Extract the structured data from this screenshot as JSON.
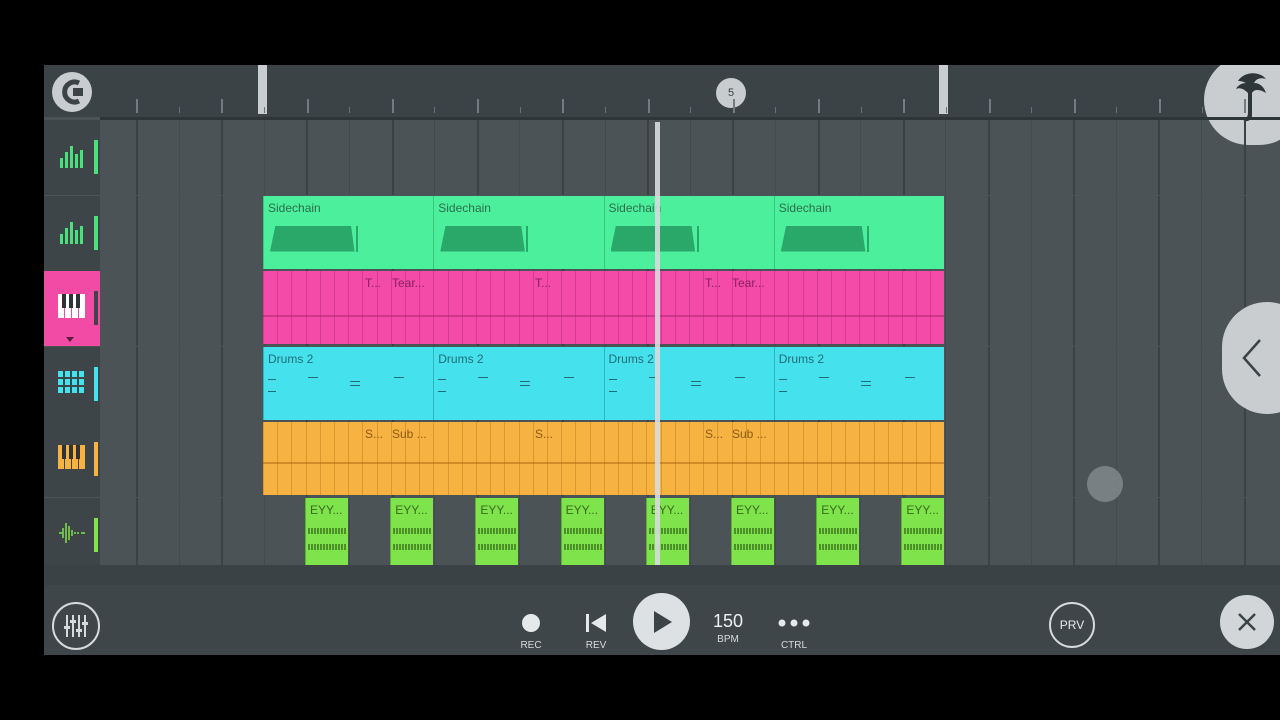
{
  "ruler": {
    "bar_number": "5"
  },
  "tracks": [
    {
      "name": "automation-track-1",
      "icon": "automation-bars-icon",
      "indicator": "#4be07d",
      "clips": []
    },
    {
      "name": "automation-track-2",
      "icon": "automation-bars-icon",
      "indicator": "#4be07d",
      "clips": [
        {
          "label": "Sidechain"
        },
        {
          "label": "Sidechain"
        },
        {
          "label": "Sidechain"
        },
        {
          "label": "Sidechain"
        }
      ]
    },
    {
      "name": "piano-track-tear",
      "icon": "piano-keys-icon",
      "indicator": "#3d4548",
      "selected": true,
      "clips": [
        {
          "label": "T..."
        },
        {
          "label": "Tear..."
        },
        {
          "label": "T..."
        },
        {
          "label": "T..."
        },
        {
          "label": "Tear..."
        }
      ]
    },
    {
      "name": "drums-track",
      "icon": "step-sequencer-icon",
      "indicator": "#45e2ee",
      "clips": [
        {
          "label": "Drums 2"
        },
        {
          "label": "Drums 2"
        },
        {
          "label": "Drums 2"
        },
        {
          "label": "Drums 2"
        }
      ]
    },
    {
      "name": "sub-track",
      "icon": "piano-keys-icon",
      "indicator": "#f7b342",
      "clips": [
        {
          "label": "S..."
        },
        {
          "label": "Sub ..."
        },
        {
          "label": "S..."
        },
        {
          "label": "S..."
        },
        {
          "label": "Sub ..."
        }
      ]
    },
    {
      "name": "audio-track-eyy",
      "icon": "waveform-icon",
      "indicator": "#7fe34c",
      "clips": [
        {
          "label": "EYY..."
        },
        {
          "label": "EYY..."
        },
        {
          "label": "EYY..."
        },
        {
          "label": "EYY..."
        },
        {
          "label": "EYY..."
        },
        {
          "label": "EYY..."
        },
        {
          "label": "EYY..."
        },
        {
          "label": "EYY..."
        }
      ]
    }
  ],
  "transport": {
    "rec_label": "REC",
    "rev_label": "REV",
    "bpm_value": "150",
    "bpm_label": "BPM",
    "ctrl_label": "CTRL",
    "prv_label": "PRV"
  },
  "colors": {
    "sidechain": "#4cef9c",
    "tear": "#f44aa8",
    "drums": "#45e2ee",
    "sub": "#f7b342",
    "eyy": "#7fe34c"
  }
}
